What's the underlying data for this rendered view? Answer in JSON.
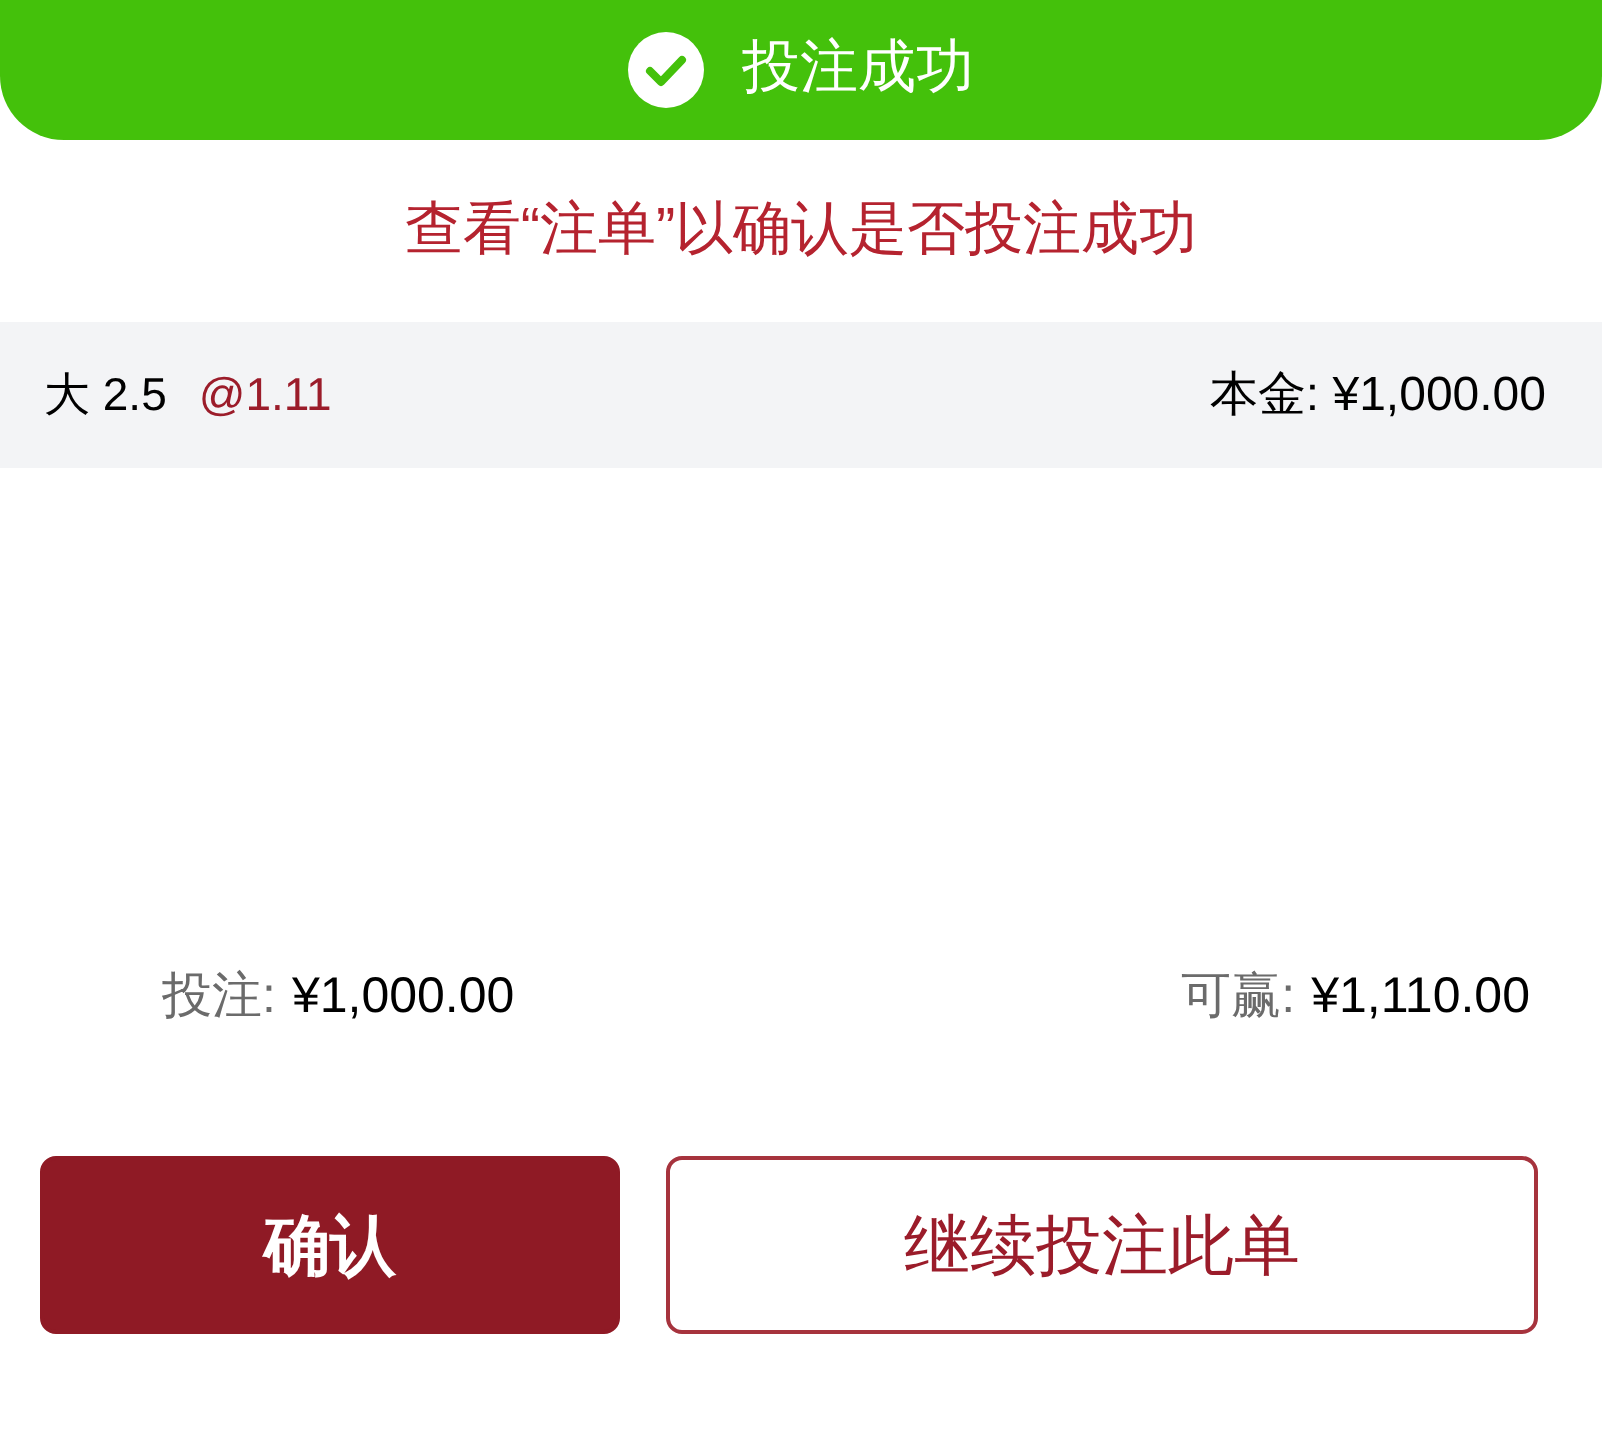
{
  "toast": {
    "title": "投注成功"
  },
  "notice": "查看“注单”以确认是否投注成功",
  "bet": {
    "selection": "大 2.5",
    "odds": "@1.11",
    "stake": "本金: ¥1,000.00"
  },
  "summary": [
    {
      "label": "投注:",
      "value": "¥1,000.00"
    },
    {
      "label": "可赢:",
      "value": "¥1,110.00"
    }
  ],
  "buttons": [
    {
      "label": "确认",
      "kind": "primary"
    },
    {
      "label": "继续投注此单",
      "kind": "outline"
    }
  ]
}
